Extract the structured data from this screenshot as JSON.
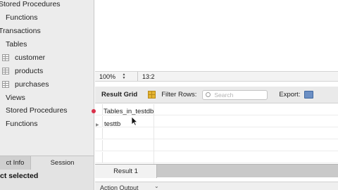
{
  "sidebar": {
    "tree": [
      {
        "label": "Stored Procedures",
        "icon": "stored-procedures-icon"
      },
      {
        "label": "Functions",
        "icon": "functions-icon"
      },
      {
        "label": "Transactions",
        "icon": ""
      },
      {
        "label": "Tables",
        "icon": "tables-icon"
      },
      {
        "label": "customer",
        "icon": "table-icon"
      },
      {
        "label": "products",
        "icon": "table-icon"
      },
      {
        "label": "purchases",
        "icon": "table-icon"
      },
      {
        "label": "Views",
        "icon": "views-icon"
      },
      {
        "label": "Stored Procedures",
        "icon": "stored-procedures-icon"
      },
      {
        "label": "Functions",
        "icon": "functions-icon"
      }
    ],
    "tabs": [
      {
        "label": "ct Info"
      },
      {
        "label": "Session"
      }
    ],
    "object_status": "ct selected"
  },
  "editor_status": {
    "zoom": "100%",
    "cursor_position": "13:2"
  },
  "result_toolbar": {
    "grid_label": "Result Grid",
    "filter_label": "Filter Rows:",
    "search_placeholder": "Search",
    "export_label": "Export:"
  },
  "grid": {
    "column_header": "Tables_in_testdb",
    "rows": [
      "testtb"
    ]
  },
  "result_tab": "Result 1",
  "action_output": "Action Output",
  "colors": {
    "sidebar_bg": "#ececec",
    "toolbar_bg": "#eaeaea",
    "marker_red": "#d9304a",
    "grid_icon_yellow": "#e5b532",
    "export_icon_blue": "#6b8fc4"
  }
}
